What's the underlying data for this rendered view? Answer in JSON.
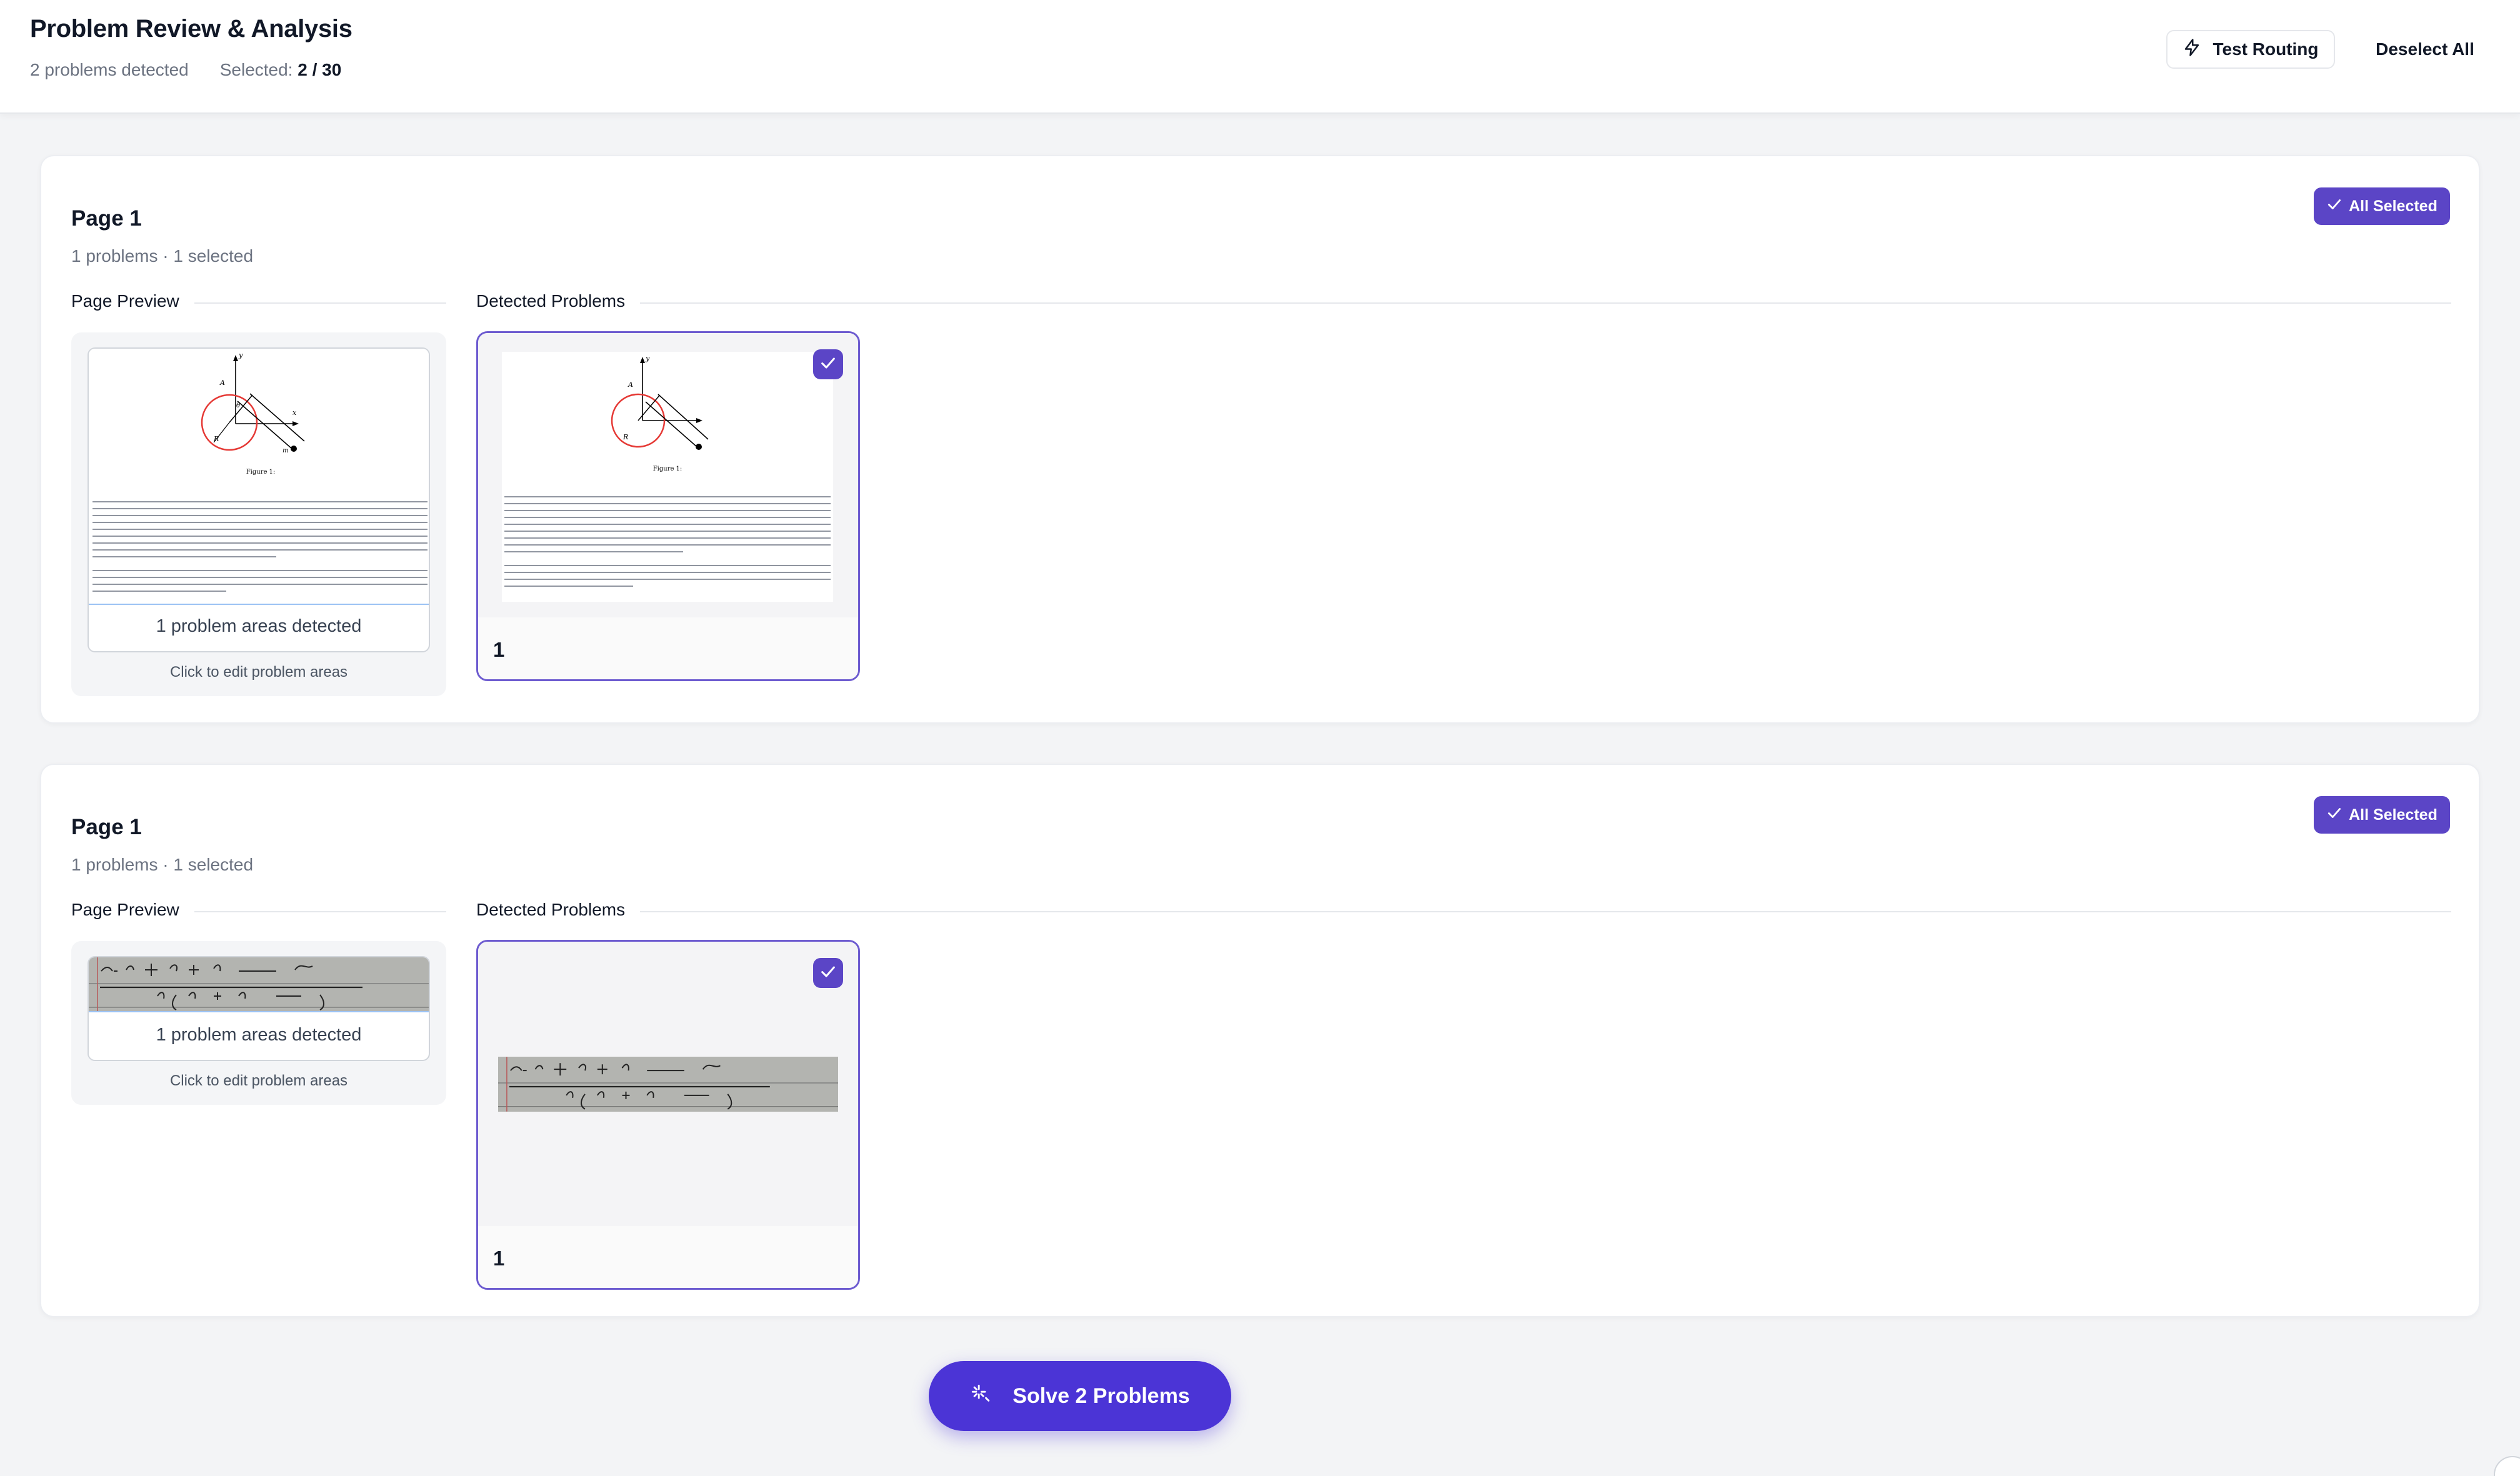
{
  "header": {
    "title": "Problem Review & Analysis",
    "problems_detected": "2 problems detected",
    "selected_label": "Selected:",
    "selected_value": "2 / 30",
    "test_routing_label": "Test Routing",
    "deselect_all_label": "Deselect All"
  },
  "pages": [
    {
      "title": "Page 1",
      "subtitle": "1 problems · 1 selected",
      "badge": "All Selected",
      "preview_label": "Page Preview",
      "detected_label": "Detected Problems",
      "preview_count": "1 problem areas detected",
      "preview_edit": "Click to edit problem areas",
      "figure_caption": "Figure 1:",
      "problems": [
        {
          "number": "1"
        }
      ]
    },
    {
      "title": "Page 1",
      "subtitle": "1 problems · 1 selected",
      "badge": "All Selected",
      "preview_label": "Page Preview",
      "detected_label": "Detected Problems",
      "preview_count": "1 problem areas detected",
      "preview_edit": "Click to edit problem areas",
      "problems": [
        {
          "number": "1"
        }
      ]
    }
  ],
  "solve_button_label": "Solve 2 Problems",
  "colors": {
    "accent": "#5b45c6",
    "solve": "#4b34d6",
    "background": "#f3f4f6"
  },
  "icons": {
    "routing": "lightning-icon",
    "check": "check-icon",
    "solve": "sparkle-icon"
  }
}
